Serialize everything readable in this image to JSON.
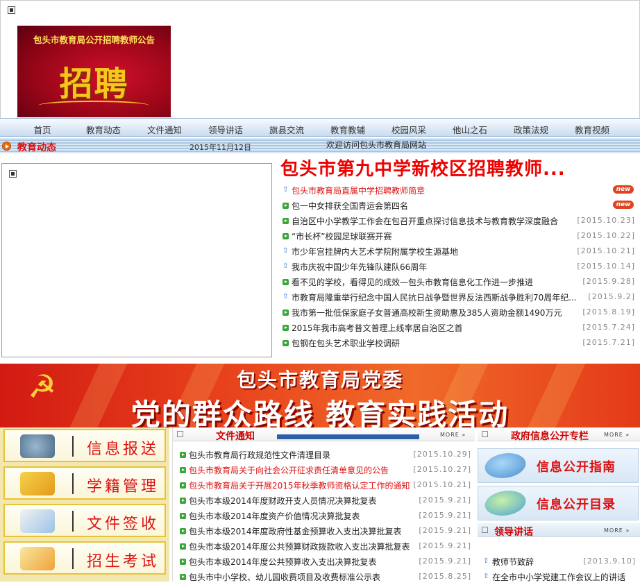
{
  "recruit_banner": {
    "title": "包头市教育局公开招聘教师公告",
    "big_text": "招聘"
  },
  "nav": [
    "首页",
    "教育动态",
    "文件通知",
    "领导讲话",
    "旗县交流",
    "教育教辅",
    "校园风采",
    "他山之石",
    "政策法规",
    "教育视频"
  ],
  "subbar": {
    "section_title": "教育动态",
    "date": "2015年11月12日",
    "welcome": "欢迎访问包头市教育局网站"
  },
  "headline": "包头市第九中学新校区招聘教师...",
  "news": [
    {
      "title": "包头市教育局直属中学招聘教师简章",
      "date": "",
      "badge": "new",
      "red": true,
      "bullet": "arrow"
    },
    {
      "title": "包一中女排获全国青运会第四名",
      "date": "",
      "badge": "new",
      "red": false,
      "bullet": "green"
    },
    {
      "title": "自治区中小学教学工作会在包召开重点探讨信息技术与教育教学深度融合",
      "date": "[2015.10.23]",
      "badge": "",
      "red": false,
      "bullet": "green"
    },
    {
      "title": "“市长杯”校园足球联赛开赛",
      "date": "[2015.10.22]",
      "badge": "",
      "red": false,
      "bullet": "green"
    },
    {
      "title": "市少年宫挂牌内大艺术学院附属学校生源基地",
      "date": "[2015.10.21]",
      "badge": "",
      "red": false,
      "bullet": "arrow"
    },
    {
      "title": "我市庆祝中国少年先锋队建队66周年",
      "date": "[2015.10.14]",
      "badge": "",
      "red": false,
      "bullet": "arrow"
    },
    {
      "title": "看不见的学校，看得见的成效—包头市教育信息化工作进一步推进",
      "date": "[2015.9.28]",
      "badge": "",
      "red": false,
      "bullet": "green"
    },
    {
      "title": "市教育局隆重举行纪念中国人民抗日战争暨世界反法西斯战争胜利70周年纪...",
      "date": "[2015.9.2]",
      "badge": "",
      "red": false,
      "bullet": "arrow"
    },
    {
      "title": "我市第一批低保家庭子女普通高校新生资助惠及385人资助金额1490万元",
      "date": "[2015.8.19]",
      "badge": "",
      "red": false,
      "bullet": "green"
    },
    {
      "title": "2015年我市高考普文普理上线率居自治区之首",
      "date": "[2015.7.24]",
      "badge": "",
      "red": false,
      "bullet": "green"
    },
    {
      "title": "包钢在包头艺术职业学校调研",
      "date": "[2015.7.21]",
      "badge": "",
      "red": false,
      "bullet": "green"
    }
  ],
  "party_banner": {
    "line1": "包头市教育局党委",
    "line2": "党的群众路线 教育实践活动"
  },
  "services": [
    {
      "label": "信息报送",
      "icon": "telephone-icon"
    },
    {
      "label": "学籍管理",
      "icon": "folder-icon"
    },
    {
      "label": "文件签收",
      "icon": "document-sign-icon"
    },
    {
      "label": "招生考试",
      "icon": "pencil-icon"
    }
  ],
  "file_panel": {
    "title": "文件通知",
    "more": "MORE",
    "items": [
      {
        "title": "包头市教育局行政规范性文件清理目录",
        "date": "[2015.10.29]",
        "red": false
      },
      {
        "title": "包头市教育局关于向社会公开征求责任清单意见的公告",
        "date": "[2015.10.27]",
        "red": true
      },
      {
        "title": "包头市教育局关于开展2015年秋季教师资格认定工作的通知",
        "date": "[2015.10.21]",
        "red": true
      },
      {
        "title": "包头市本级2014年度财政开支人员情况决算批复表",
        "date": "[2015.9.21]",
        "red": false
      },
      {
        "title": "包头市本级2014年度资产价值情况决算批复表",
        "date": "[2015.9.21]",
        "red": false
      },
      {
        "title": "包头市本级2014年度政府性基金预算收入支出决算批复表",
        "date": "[2015.9.21]",
        "red": false
      },
      {
        "title": "包头市本级2014年度公共预算财政拨款收入支出决算批复表",
        "date": "[2015.9.21]",
        "red": false
      },
      {
        "title": "包头市本级2014年度公共预算收入支出决算批复表",
        "date": "[2015.9.21]",
        "red": false
      },
      {
        "title": "包头市中小学校、幼儿园收费项目及收费标准公示表",
        "date": "[2015.8.25]",
        "red": false
      }
    ]
  },
  "gov_panel": {
    "title": "政府信息公开专栏",
    "more": "MORE",
    "buttons": [
      "信息公开指南",
      "信息公开目录"
    ]
  },
  "leader_panel": {
    "title": "领导讲话",
    "more": "MORE",
    "items": [
      {
        "title": "教师节致辞",
        "date": "[2013.9.10]"
      },
      {
        "title": "在全市中小学党建工作会议上的讲话",
        "date": ""
      }
    ]
  }
}
